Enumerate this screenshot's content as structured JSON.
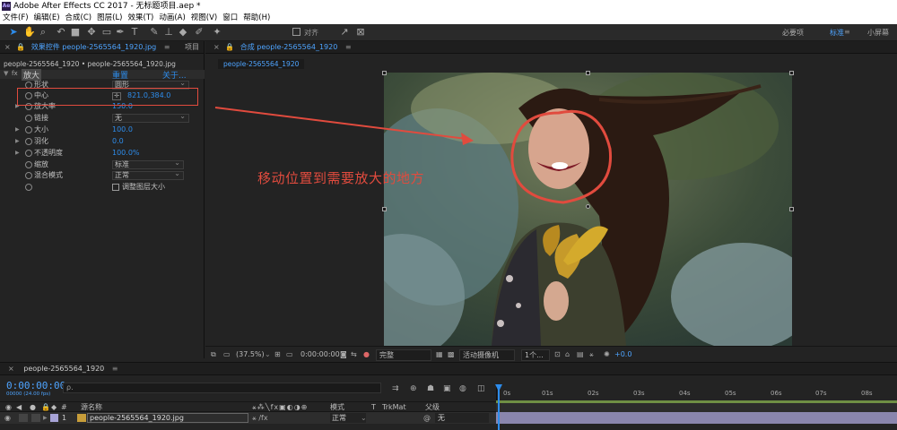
{
  "window": {
    "title": "Adobe After Effects CC 2017 - 无标题项目.aep *",
    "logo_text": "Ae"
  },
  "menu": [
    "文件(F)",
    "编辑(E)",
    "合成(C)",
    "图层(L)",
    "效果(T)",
    "动画(A)",
    "视图(V)",
    "窗口",
    "帮助(H)"
  ],
  "toolbar": {
    "snap_label": "对齐",
    "workspaces": [
      "必要项",
      "标准",
      "小屏幕"
    ],
    "active_workspace": "标准"
  },
  "effect_panel": {
    "tab_label": "效果控件 people-2565564_1920.jpg",
    "project_tab": "项目",
    "title": "people-2565564_1920 • people-2565564_1920.jpg",
    "effect_name": "放大",
    "reset_label": "重置",
    "about_label": "关于...",
    "properties": [
      {
        "label": "形状",
        "value": "圆形",
        "type": "dropdown"
      },
      {
        "label": "中心",
        "value": "821.0,384.0",
        "type": "point"
      },
      {
        "label": "放大率",
        "value": "150.0",
        "type": "number"
      },
      {
        "label": "链接",
        "value": "无",
        "type": "dropdown"
      },
      {
        "label": "大小",
        "value": "100.0",
        "type": "number"
      },
      {
        "label": "羽化",
        "value": "0.0",
        "type": "number"
      },
      {
        "label": "不透明度",
        "value": "100.0%",
        "type": "number"
      },
      {
        "label": "缩放",
        "value": "标准",
        "type": "dropdown"
      },
      {
        "label": "混合模式",
        "value": "正常",
        "type": "dropdown"
      },
      {
        "label": "调整图层大小",
        "value": "",
        "type": "checkbox"
      }
    ]
  },
  "comp_panel": {
    "tab_label": "合成 people-2565564_1920",
    "subtab": "people-2565564_1920",
    "annotation": "移动位置到需要放大的地方"
  },
  "viewer_bar": {
    "zoom": "(37.5%)",
    "timecode": "0:00:00:00",
    "quality": "完整",
    "camera": "活动摄像机",
    "views": "1个...",
    "exposure": "+0.0"
  },
  "timeline": {
    "tab_label": "people-2565564_1920",
    "timecode": "0:00:00:00",
    "fps": "00000 (24.00 fps)",
    "search_placeholder": "ρ.",
    "col_hash": "#",
    "col_source": "源名称",
    "col_mode": "模式",
    "col_t": "T",
    "col_trkmat": "TrkMat",
    "col_parent": "父级",
    "layer_index": "1",
    "layer_name": "people-2565564_1920.jpg",
    "layer_mode": "正常",
    "layer_parent": "无",
    "ruler": [
      "0s",
      "01s",
      "02s",
      "03s",
      "04s",
      "05s",
      "06s",
      "07s",
      "08s"
    ]
  },
  "colors": {
    "accent": "#2d8ceb",
    "annotation": "#e14b3e",
    "bg": "#232323"
  }
}
